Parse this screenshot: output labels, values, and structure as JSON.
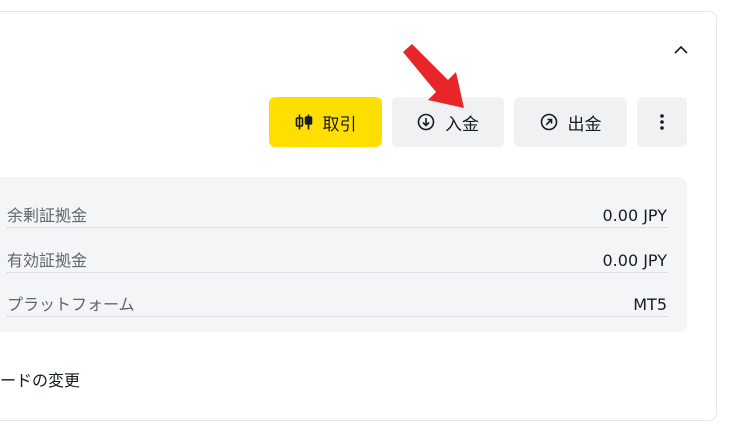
{
  "actions": {
    "trade_label": "取引",
    "deposit_label": "入金",
    "withdraw_label": "出金"
  },
  "account_details": [
    {
      "label": "余剰証拠金",
      "value": "0.00 JPY"
    },
    {
      "label": "有効証拠金",
      "value": "0.00 JPY"
    },
    {
      "label": "プラットフォーム",
      "value": "MT5"
    }
  ],
  "password_link": "ードの変更",
  "colors": {
    "trade_button": "#ffde02",
    "secondary_button": "#eff1f2",
    "panel": "#f3f5f7",
    "annotation_arrow": "#e8262a"
  },
  "icons": {
    "collapse": "chevron-up-icon",
    "trade": "candlestick-icon",
    "deposit": "arrow-down-circle-icon",
    "withdraw": "arrow-up-right-circle-icon",
    "more": "more-vertical-icon"
  }
}
